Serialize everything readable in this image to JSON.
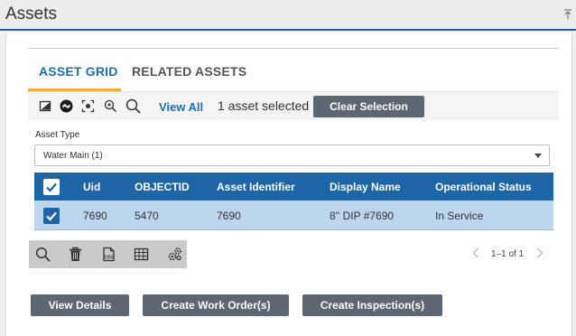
{
  "panel": {
    "title": "Assets"
  },
  "tabs": [
    {
      "label": "ASSET GRID",
      "active": true
    },
    {
      "label": "RELATED ASSETS",
      "active": false
    }
  ],
  "toolbar": {
    "icons": [
      "image-layer-icon",
      "link-icon",
      "zoom-to-selection-icon",
      "zoom-in-icon",
      "search-icon"
    ],
    "view_all": "View All",
    "selection_text": "1 asset selected",
    "clear_selection": "Clear Selection"
  },
  "asset_type": {
    "label": "Asset Type",
    "value": "Water Main (1)"
  },
  "grid": {
    "columns": [
      "Uid",
      "OBJECTID",
      "Asset Identifier",
      "Display Name",
      "Operational Status"
    ],
    "rows": [
      {
        "selected": true,
        "cells": [
          "7690",
          "5470",
          "7690",
          "8'' DIP #7690",
          "In Service"
        ]
      }
    ]
  },
  "bottom_toolbar": {
    "icons": [
      "search-icon",
      "trash-icon",
      "csv-export-icon",
      "table-icon",
      "settings-gears-icon"
    ]
  },
  "pager": {
    "text": "1–1 of 1"
  },
  "actions": {
    "view_details": "View Details",
    "create_work_order": "Create Work Order(s)",
    "create_inspection": "Create Inspection(s)"
  },
  "colors": {
    "accent_blue": "#1e65a7",
    "tab_blue": "#1d6fb5",
    "tab_underline": "#f0ad3a",
    "selected_row": "#bcd6ee",
    "button_gray": "#5d6673"
  }
}
